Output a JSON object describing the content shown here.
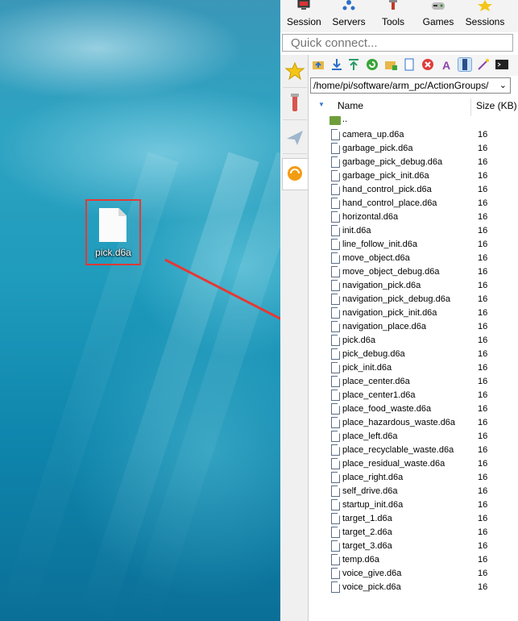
{
  "menubar": {
    "items": [
      {
        "label": "Session",
        "icon": "monitor-icon"
      },
      {
        "label": "Servers",
        "icon": "servers-icon"
      },
      {
        "label": "Tools",
        "icon": "tools-icon"
      },
      {
        "label": "Games",
        "icon": "gamepad-icon"
      },
      {
        "label": "Sessions",
        "icon": "star-icon"
      }
    ]
  },
  "quick_connect": {
    "placeholder": "Quick connect..."
  },
  "side_tabs": [
    "star-icon",
    "tools-icon",
    "send-icon",
    "sftp-icon"
  ],
  "toolbar": [
    "folder-up-icon",
    "download-icon",
    "upload-icon",
    "refresh-icon",
    "new-folder-icon",
    "new-file-icon",
    "delete-icon",
    "rename-icon",
    "text-icon",
    "wand-icon",
    "terminal-icon"
  ],
  "path": {
    "value": "/home/pi/software/arm_pc/ActionGroups/"
  },
  "columns": {
    "name": "Name",
    "size": "Size (KB)"
  },
  "parent_dir": "..",
  "files": [
    {
      "name": "camera_up.d6a",
      "size": "16"
    },
    {
      "name": "garbage_pick.d6a",
      "size": "16"
    },
    {
      "name": "garbage_pick_debug.d6a",
      "size": "16"
    },
    {
      "name": "garbage_pick_init.d6a",
      "size": "16"
    },
    {
      "name": "hand_control_pick.d6a",
      "size": "16"
    },
    {
      "name": "hand_control_place.d6a",
      "size": "16"
    },
    {
      "name": "horizontal.d6a",
      "size": "16"
    },
    {
      "name": "init.d6a",
      "size": "16"
    },
    {
      "name": "line_follow_init.d6a",
      "size": "16"
    },
    {
      "name": "move_object.d6a",
      "size": "16"
    },
    {
      "name": "move_object_debug.d6a",
      "size": "16"
    },
    {
      "name": "navigation_pick.d6a",
      "size": "16"
    },
    {
      "name": "navigation_pick_debug.d6a",
      "size": "16"
    },
    {
      "name": "navigation_pick_init.d6a",
      "size": "16"
    },
    {
      "name": "navigation_place.d6a",
      "size": "16"
    },
    {
      "name": "pick.d6a",
      "size": "16"
    },
    {
      "name": "pick_debug.d6a",
      "size": "16"
    },
    {
      "name": "pick_init.d6a",
      "size": "16"
    },
    {
      "name": "place_center.d6a",
      "size": "16"
    },
    {
      "name": "place_center1.d6a",
      "size": "16"
    },
    {
      "name": "place_food_waste.d6a",
      "size": "16"
    },
    {
      "name": "place_hazardous_waste.d6a",
      "size": "16"
    },
    {
      "name": "place_left.d6a",
      "size": "16"
    },
    {
      "name": "place_recyclable_waste.d6a",
      "size": "16"
    },
    {
      "name": "place_residual_waste.d6a",
      "size": "16"
    },
    {
      "name": "place_right.d6a",
      "size": "16"
    },
    {
      "name": "self_drive.d6a",
      "size": "16"
    },
    {
      "name": "startup_init.d6a",
      "size": "16"
    },
    {
      "name": "target_1.d6a",
      "size": "16"
    },
    {
      "name": "target_2.d6a",
      "size": "16"
    },
    {
      "name": "target_3.d6a",
      "size": "16"
    },
    {
      "name": "temp.d6a",
      "size": "16"
    },
    {
      "name": "voice_give.d6a",
      "size": "16"
    },
    {
      "name": "voice_pick.d6a",
      "size": "16"
    }
  ],
  "desktop_file": {
    "label": "pick.d6a",
    "icon": "document-icon"
  },
  "colors": {
    "highlight_box": "#e53935",
    "arrow": "#e53935"
  }
}
